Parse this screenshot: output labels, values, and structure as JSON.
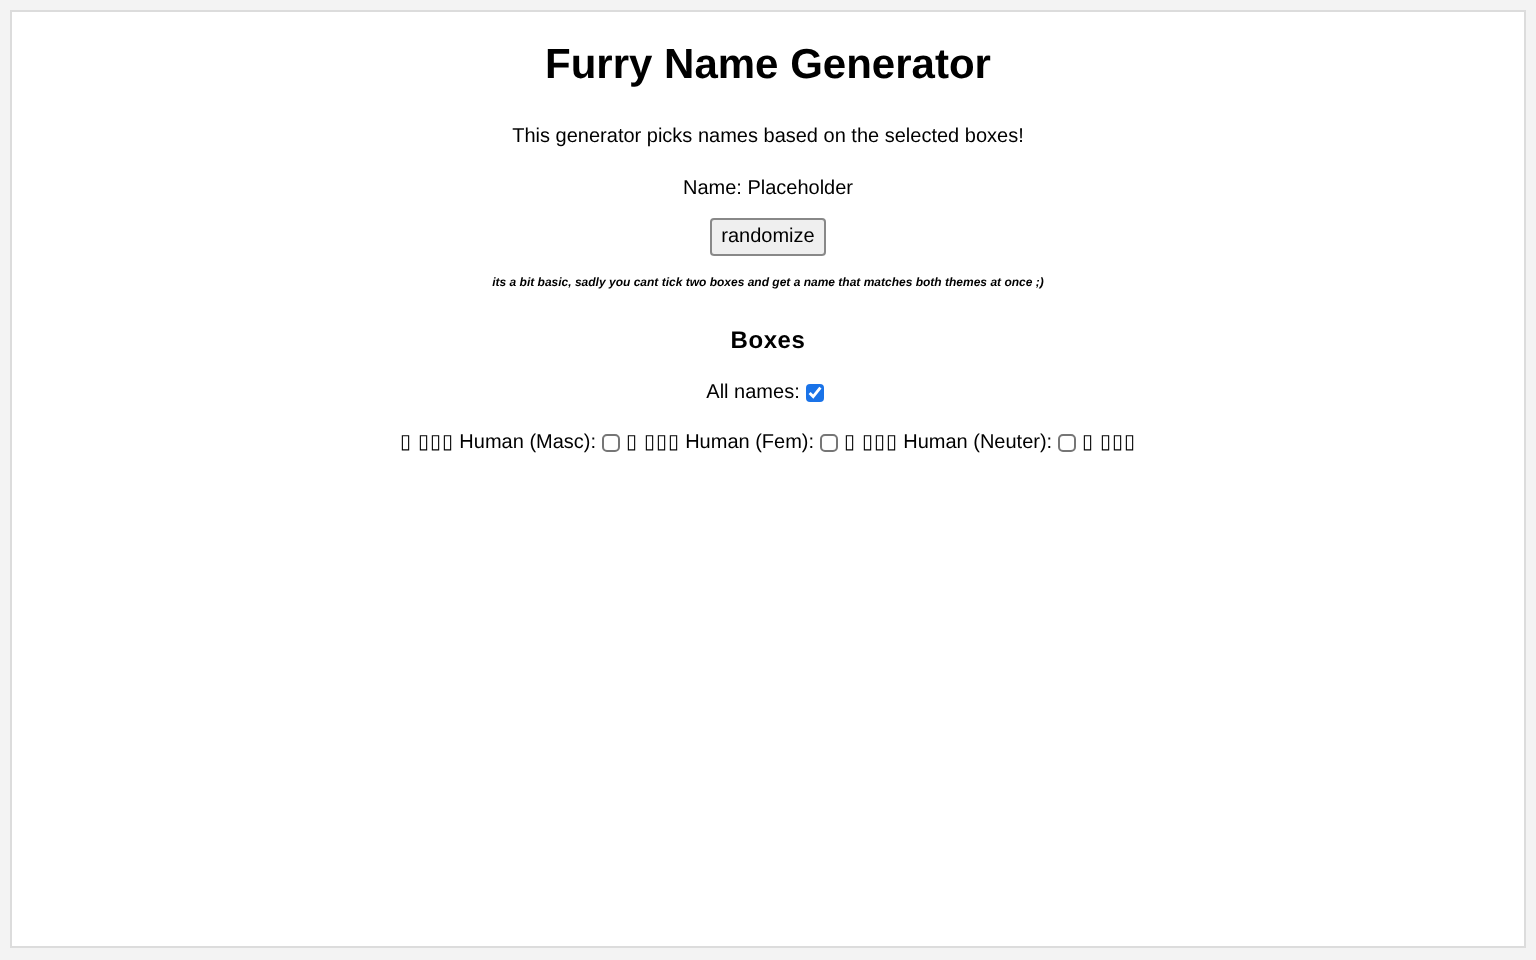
{
  "title": "Furry Name Generator",
  "intro": "This generator picks names based on the selected boxes!",
  "name_line": "Name: Placeholder",
  "randomize_button": "randomize",
  "note": "its a bit basic, sadly you cant tick two boxes and get a name that matches both themes at once ;)",
  "boxes_heading": "Boxes",
  "all_names": {
    "label": "All names:",
    "checked": true
  },
  "options": [
    {
      "label": "▯ ▯▯▯ Human (Masc):",
      "checked": false
    },
    {
      "label": "▯ ▯▯▯ Human (Fem):",
      "checked": false
    },
    {
      "label": "▯ ▯▯▯ Human (Neuter):",
      "checked": false
    }
  ],
  "trailing_text": "▯ ▯▯▯"
}
